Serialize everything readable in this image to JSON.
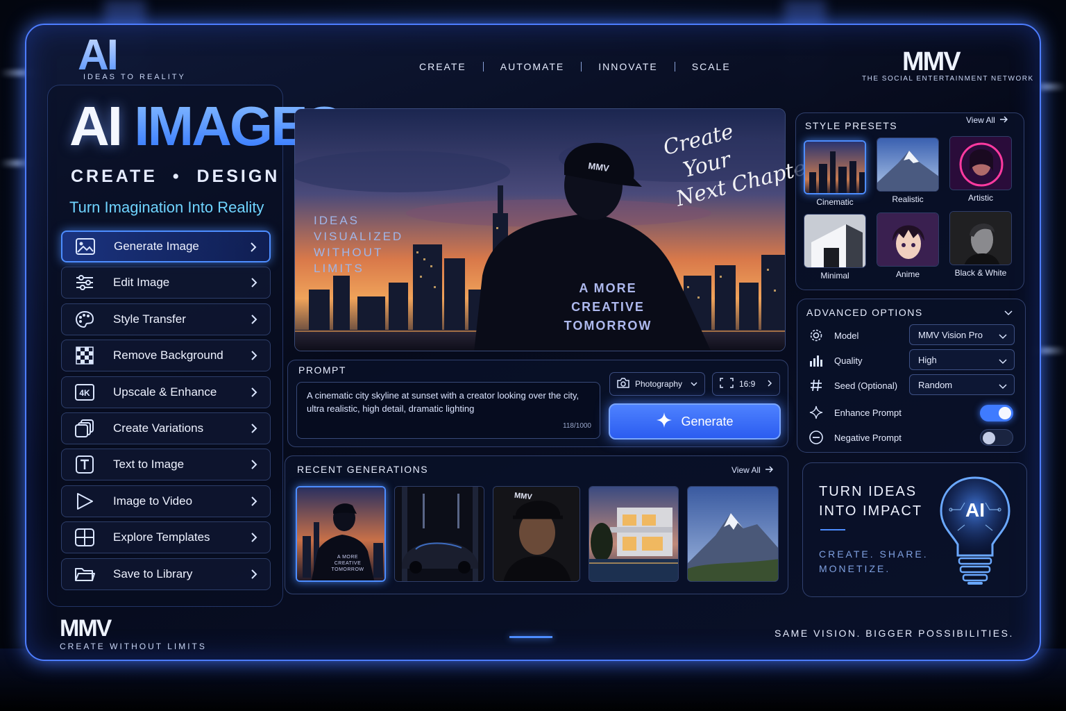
{
  "brand": {
    "logo": "AI",
    "logo_tagline": "IDEAS TO REALITY",
    "partner": "MMV",
    "partner_tagline": "THE SOCIAL ENTERTAINMENT NETWORK"
  },
  "topnav": [
    "CREATE",
    "AUTOMATE",
    "INNOVATE",
    "SCALE"
  ],
  "hero": {
    "title_part1": "AI",
    "title_part2": "IMAGES",
    "subtitle": "CREATE  •  DESIGN  •  TRANSFORM",
    "tagline": "Turn Imagination Into Reality"
  },
  "menu": [
    {
      "label": "Generate Image",
      "icon": "image-icon",
      "active": true
    },
    {
      "label": "Edit Image",
      "icon": "sliders-icon"
    },
    {
      "label": "Style Transfer",
      "icon": "palette-icon"
    },
    {
      "label": "Remove Background",
      "icon": "checker-icon"
    },
    {
      "label": "Upscale & Enhance",
      "icon": "4k-icon"
    },
    {
      "label": "Create Variations",
      "icon": "copy-icon"
    },
    {
      "label": "Text to Image",
      "icon": "text-icon"
    },
    {
      "label": "Image to Video",
      "icon": "play-icon"
    },
    {
      "label": "Explore Templates",
      "icon": "grid-icon"
    },
    {
      "label": "Save to Library",
      "icon": "folder-icon"
    }
  ],
  "preview": {
    "left_text": [
      "IDEAS",
      "VISUALIZED",
      "WITHOUT",
      "LIMITS"
    ],
    "cap_text": "MMV",
    "back_text": [
      "A MORE",
      "CREATIVE",
      "TOMORROW"
    ],
    "script_text": [
      "Create",
      "Your",
      "Next Chapter"
    ]
  },
  "prompt": {
    "title": "PROMPT",
    "value": "A cinematic city skyline at sunset with a creator looking over the city, ultra realistic, high detail, dramatic lighting",
    "count": "118/1000",
    "style_chip": "Photography",
    "ratio_chip": "16:9",
    "generate_label": "Generate"
  },
  "recent": {
    "title": "RECENT GENERATIONS",
    "view_all": "View All",
    "thumb1_text": [
      "A MORE",
      "CREATIVE",
      "TOMORROW"
    ],
    "thumb3_cap": "MMV"
  },
  "style_presets": {
    "title": "STYLE PRESETS",
    "view_all": "View All",
    "items": [
      "Cinematic",
      "Realistic",
      "Artistic",
      "Minimal",
      "Anime",
      "Black & White"
    ]
  },
  "advanced": {
    "title": "ADVANCED OPTIONS",
    "model_label": "Model",
    "model_value": "MMV Vision Pro",
    "quality_label": "Quality",
    "quality_value": "High",
    "seed_label": "Seed (Optional)",
    "seed_value": "Random",
    "enhance_label": "Enhance Prompt",
    "enhance_on": true,
    "negative_label": "Negative Prompt",
    "negative_on": false
  },
  "impact": {
    "title_lines": [
      "TURN IDEAS",
      "INTO IMPACT"
    ],
    "sub_lines": [
      "CREATE. SHARE.",
      "MONETIZE."
    ],
    "bulb_text": "AI"
  },
  "footer": {
    "brand": "MMV",
    "tagline": "CREATE WITHOUT LIMITS",
    "right": "SAME VISION. BIGGER POSSIBILITIES."
  },
  "colors": {
    "accent": "#4d8dff",
    "cyan": "#6fd4ff",
    "bg": "#060a1a"
  }
}
